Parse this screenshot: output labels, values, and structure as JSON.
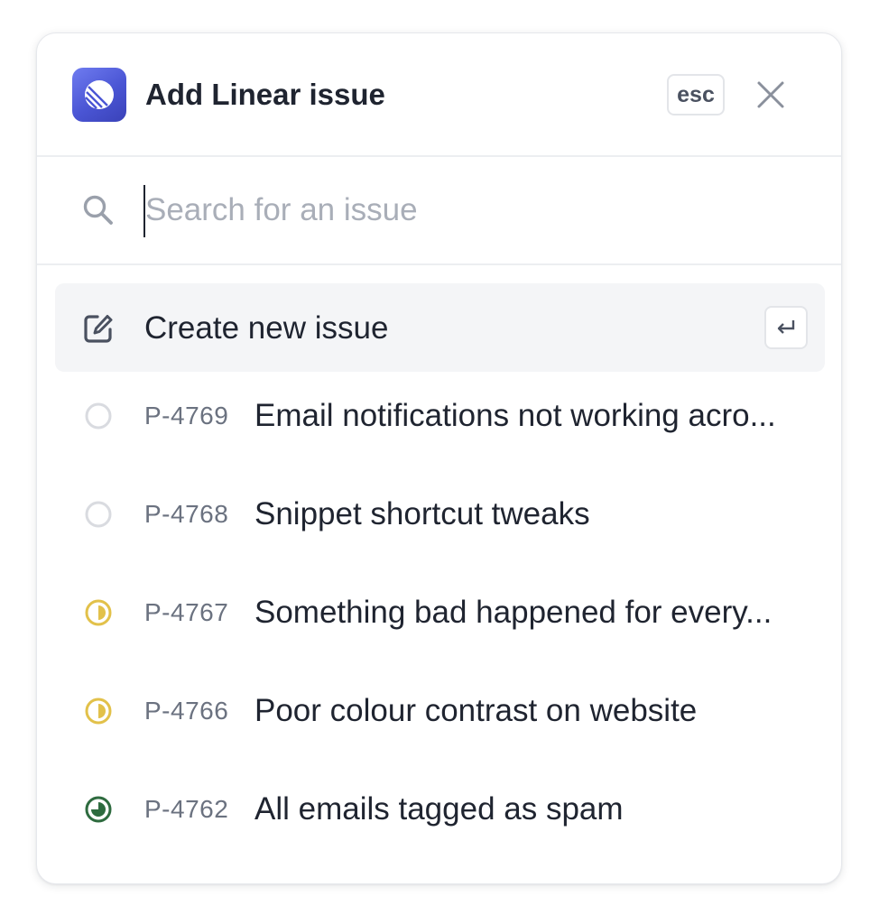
{
  "dialog": {
    "title": "Add Linear issue",
    "app_icon": "linear-logo-icon",
    "esc_label": "esc",
    "close_icon": "close-icon"
  },
  "search": {
    "placeholder": "Search for an issue",
    "value": "",
    "icon": "search-icon"
  },
  "create": {
    "label": "Create new issue",
    "icon": "edit-square-icon",
    "shortcut_icon": "enter-key-icon"
  },
  "issues": [
    {
      "id": "P-4769",
      "title": "Email notifications not working acro...",
      "status": "todo",
      "status_icon": "empty-circle-icon"
    },
    {
      "id": "P-4768",
      "title": "Snippet shortcut tweaks",
      "status": "todo",
      "status_icon": "empty-circle-icon"
    },
    {
      "id": "P-4767",
      "title": "Something bad happened for every...",
      "status": "in-progress",
      "status_icon": "half-circle-icon"
    },
    {
      "id": "P-4766",
      "title": "Poor colour contrast on website",
      "status": "in-progress",
      "status_icon": "half-circle-icon"
    },
    {
      "id": "P-4762",
      "title": "All emails tagged as spam",
      "status": "in-review",
      "status_icon": "three-quarter-circle-icon"
    }
  ],
  "colors": {
    "todo": "#d9dbe0",
    "in_progress": "#e2c14a",
    "in_review": "#2e6b3f",
    "accent": "#5e6ad2",
    "text_primary": "#1f2430",
    "text_secondary": "#6b7280",
    "placeholder": "#a9aeb8",
    "highlight_bg": "#f4f5f7"
  }
}
